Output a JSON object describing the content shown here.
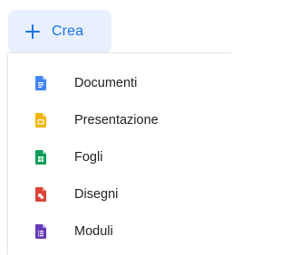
{
  "create_button": {
    "label": "Crea",
    "icon": "plus-icon",
    "color": "#1a73e8",
    "background": "#e8f0fe"
  },
  "menu": {
    "items": [
      {
        "label": "Documenti",
        "icon": "docs-icon",
        "color": "#4285f4"
      },
      {
        "label": "Presentazione",
        "icon": "slides-icon",
        "color": "#f4b400"
      },
      {
        "label": "Fogli",
        "icon": "sheets-icon",
        "color": "#0f9d58"
      },
      {
        "label": "Disegni",
        "icon": "drawings-icon",
        "color": "#db4437"
      },
      {
        "label": "Moduli",
        "icon": "forms-icon",
        "color": "#673ab7"
      }
    ]
  }
}
